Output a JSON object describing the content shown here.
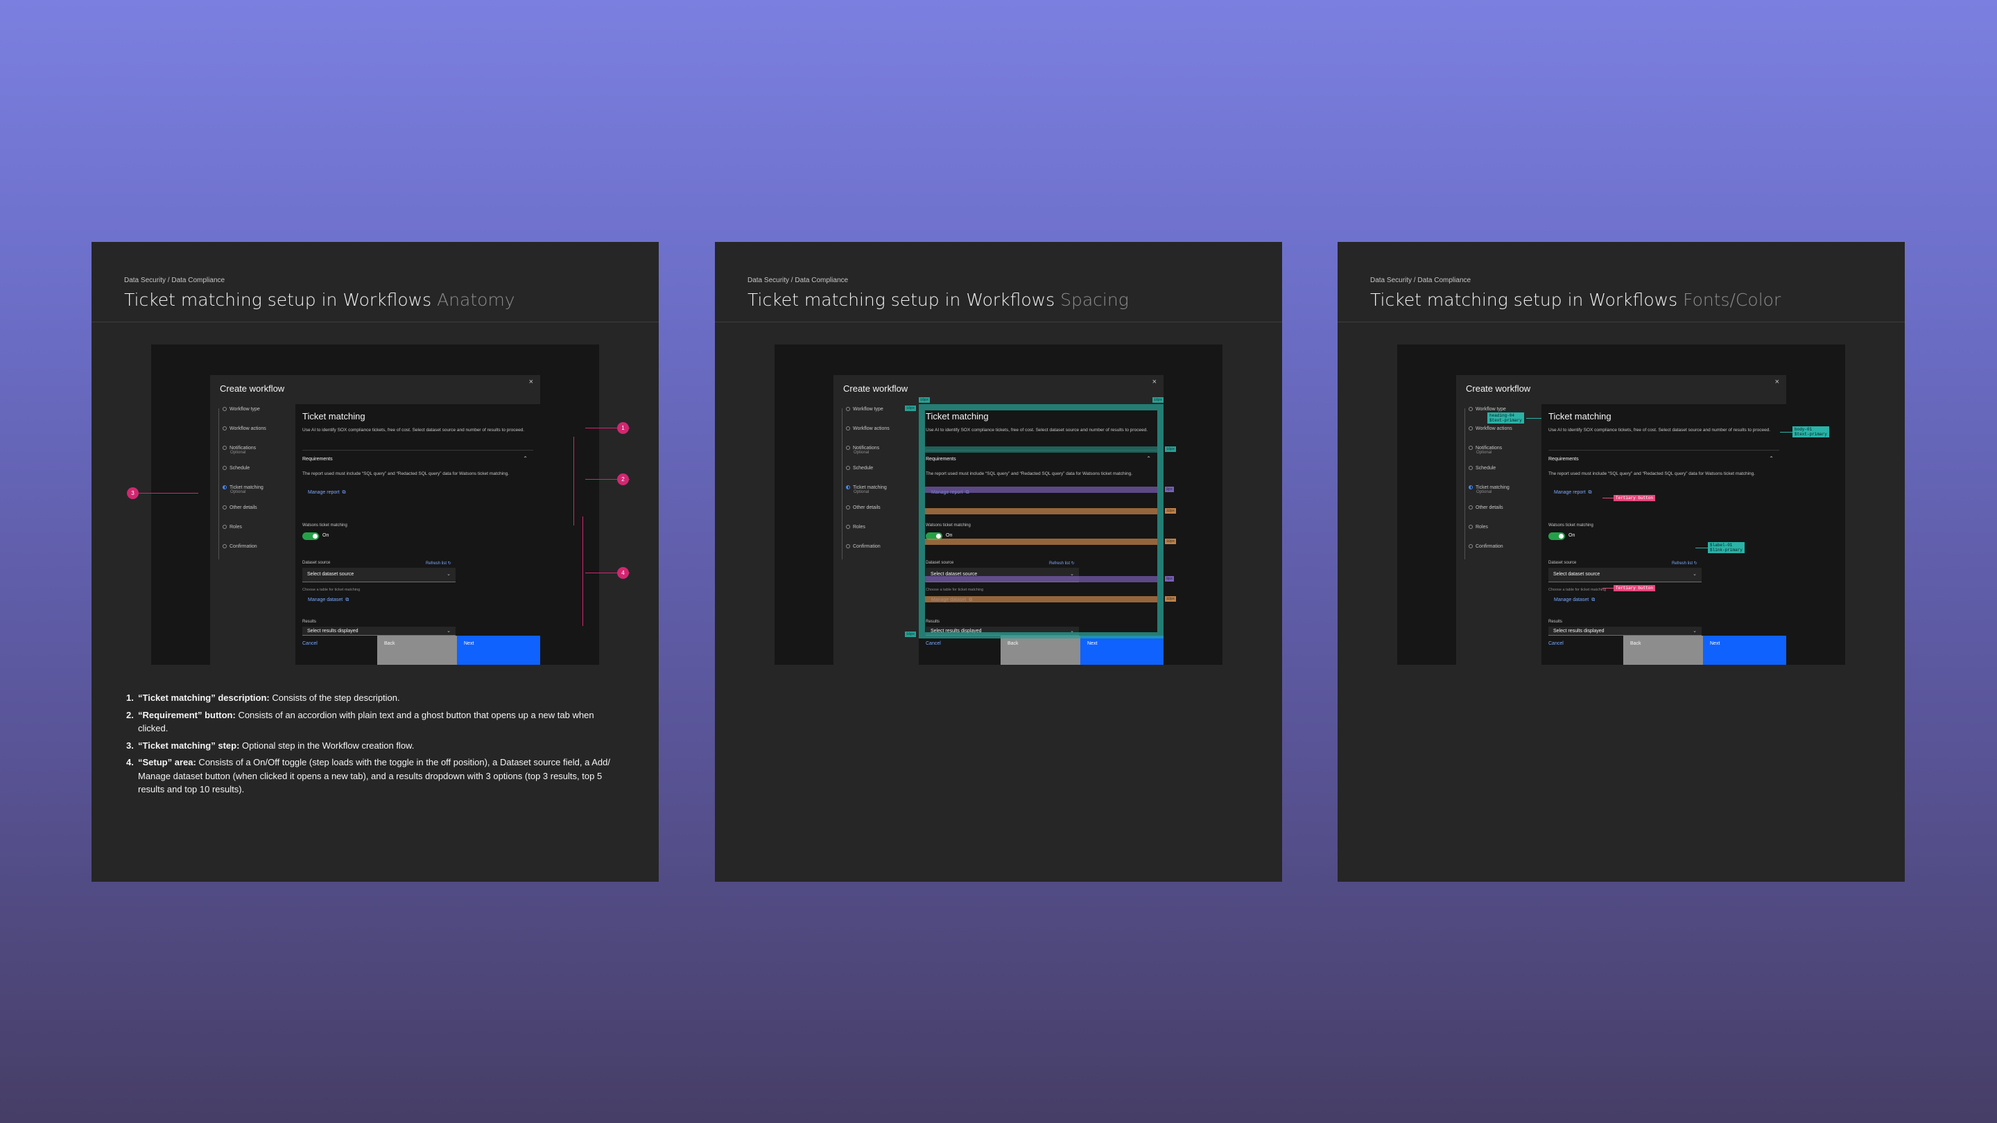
{
  "breadcrumb": "Data Security / Data Compliance",
  "cards": [
    {
      "title": "Ticket matching setup in Workflows",
      "subtitle": "Anatomy"
    },
    {
      "title": "Ticket matching setup in Workflows",
      "subtitle": "Spacing"
    },
    {
      "title": "Ticket matching setup in Workflows",
      "subtitle": "Fonts/Color"
    }
  ],
  "modal": {
    "title": "Create workflow",
    "close": "×",
    "nav": [
      {
        "label": "Workflow type",
        "optional": ""
      },
      {
        "label": "Workflow actions",
        "optional": ""
      },
      {
        "label": "Notifications",
        "optional": "Optional"
      },
      {
        "label": "Schedule",
        "optional": ""
      },
      {
        "label": "Ticket matching",
        "optional": "Optional"
      },
      {
        "label": "Other details",
        "optional": ""
      },
      {
        "label": "Roles",
        "optional": ""
      },
      {
        "label": "Confirmation",
        "optional": ""
      }
    ],
    "panel_title": "Ticket matching",
    "description": "Use AI to identify SOX compliance tickets, free of cost. Select dataset source and number of results to proceed.",
    "accordion_label": "Requirements",
    "accordion_text": "The report used must include “SQL query” and “Redacted SQL query” data for Watsons ticket matching.",
    "manage_report": "Manage report",
    "toggle_label": "Watsons ticket matching",
    "toggle_state": "On",
    "dataset_label": "Dataset source",
    "refresh": "Refresh list",
    "dataset_placeholder": "Select dataset source",
    "dataset_helper": "Choose a table for ticket matching",
    "manage_dataset": "Manage dataset",
    "results_label": "Results",
    "results_placeholder": "Select results displayed",
    "cancel": "Cancel",
    "back": "Back",
    "next": "Next"
  },
  "anatomy": {
    "badges": [
      "1",
      "2",
      "3",
      "4"
    ],
    "notes": [
      {
        "num": "1.",
        "title": "“Ticket matching” description:",
        "text": " Consists of the step description."
      },
      {
        "num": "2.",
        "title": "“Requirement” button:",
        "text": " Consists of an accordion with plain text and a ghost button that opens up a new tab when clicked."
      },
      {
        "num": "3.",
        "title": "“Ticket matching” step:",
        "text": "  Optional step in the Workflow creation flow."
      },
      {
        "num": "4.",
        "title": "“Setup” area:",
        "text": "  Consists of a On/Off toggle (step loads with the toggle in the off position), a Dataset source field, a Add/ Manage dataset button (when clicked it opens a new tab), and a results dropdown with 3 options (top 3 results, top 5 results and top 10 results)."
      }
    ]
  },
  "spacing": {
    "tags": [
      "16px",
      "16px",
      "16px",
      "16px",
      "8px",
      "32px",
      "32px",
      "8px",
      "32px",
      "16px"
    ],
    "colors": {
      "teal": "#2aa094",
      "purple": "#7b5fb5",
      "orange": "#c0814a"
    }
  },
  "fonts": {
    "heading": "heading-04\n$text-primary",
    "body": "body-01\n$text-primary",
    "tertiary1": "Tertiary button",
    "tertiary2": "Tertiary button",
    "label": "$label-01\n$link-primary",
    "colors": {
      "teal": "#2ab3a7",
      "pink": "#e8467c"
    }
  }
}
